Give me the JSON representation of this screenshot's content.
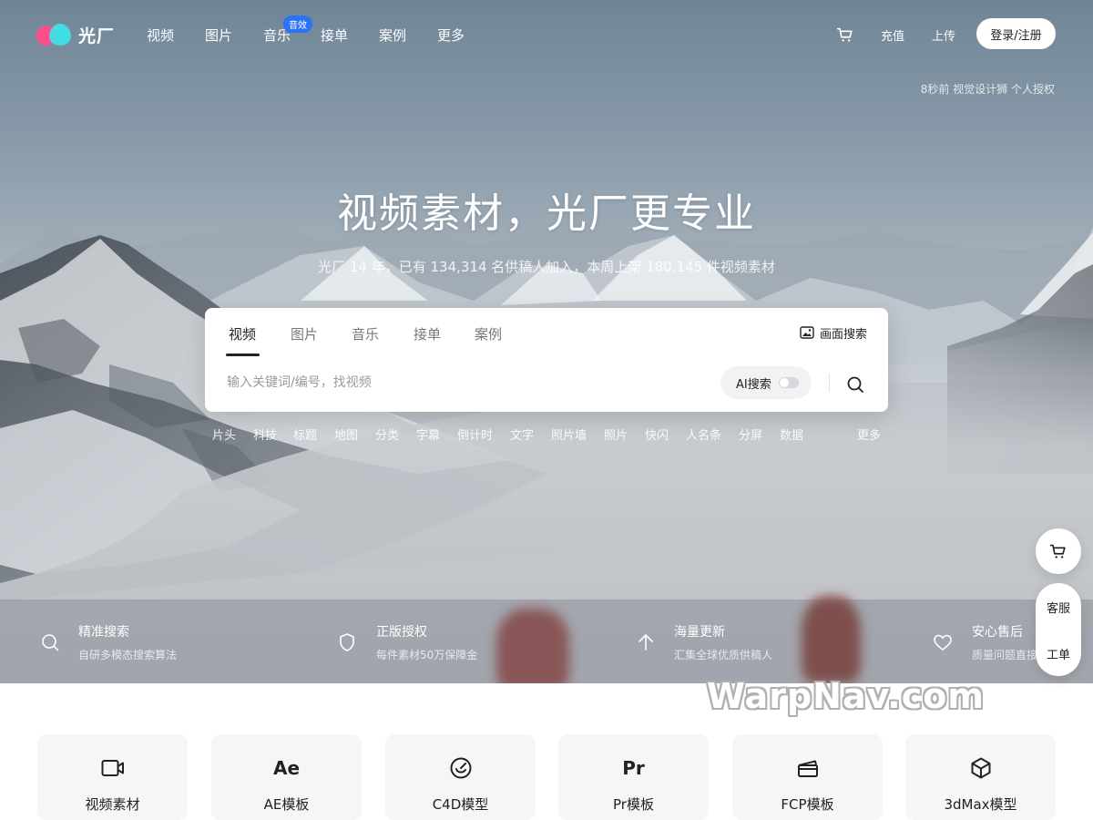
{
  "brand": {
    "name": "光厂"
  },
  "nav": {
    "links": [
      "视频",
      "图片",
      "音乐",
      "接单",
      "案例",
      "更多"
    ],
    "music_badge": "音效",
    "recharge": "充值",
    "upload": "上传",
    "login": "登录/注册"
  },
  "hero": {
    "credit": "8秒前 视觉设计狮 个人授权",
    "headline": "视频素材，光厂更专业",
    "subline": "光厂 14 年，已有 134,314 名供稿人加入，本周上架 180,145 件视频素材"
  },
  "search": {
    "tabs": [
      "视频",
      "图片",
      "音乐",
      "接单",
      "案例"
    ],
    "active_tab": "视频",
    "image_search": "画面搜索",
    "placeholder": "输入关键词/编号，找视频",
    "value": "",
    "ai_search": "AI搜索",
    "ai_toggle_on": false
  },
  "tags": [
    "片头",
    "科技",
    "标题",
    "地图",
    "分类",
    "字幕",
    "倒计时",
    "文字",
    "照片墙",
    "照片",
    "快闪",
    "人名条",
    "分屏",
    "数据"
  ],
  "tags_more": "更多",
  "features": [
    {
      "icon": "search-icon",
      "title": "精准搜索",
      "desc": "自研多模态搜索算法"
    },
    {
      "icon": "shield-icon",
      "title": "正版授权",
      "desc": "每件素材50万保障金"
    },
    {
      "icon": "arrow-up-icon",
      "title": "海量更新",
      "desc": "汇集全球优质供稿人"
    },
    {
      "icon": "heart-icon",
      "title": "安心售后",
      "desc": "质量问题直接退"
    }
  ],
  "float": {
    "service": "客服",
    "ticket": "工单"
  },
  "watermark": "WarpNav.com",
  "categories": [
    {
      "icon": "video-camera-icon",
      "label": "视频素材"
    },
    {
      "icon": "ae-icon",
      "icon_text": "Ae",
      "label": "AE模板"
    },
    {
      "icon": "c4d-icon",
      "label": "C4D模型"
    },
    {
      "icon": "pr-icon",
      "icon_text": "Pr",
      "label": "Pr模板"
    },
    {
      "icon": "clapperboard-icon",
      "label": "FCP模板"
    },
    {
      "icon": "cube-icon",
      "label": "3dMax模型"
    }
  ],
  "colors": {
    "badge": "#2b73f6",
    "logo_pink": "#ff4f8b",
    "logo_cyan": "#3fe0e7"
  }
}
